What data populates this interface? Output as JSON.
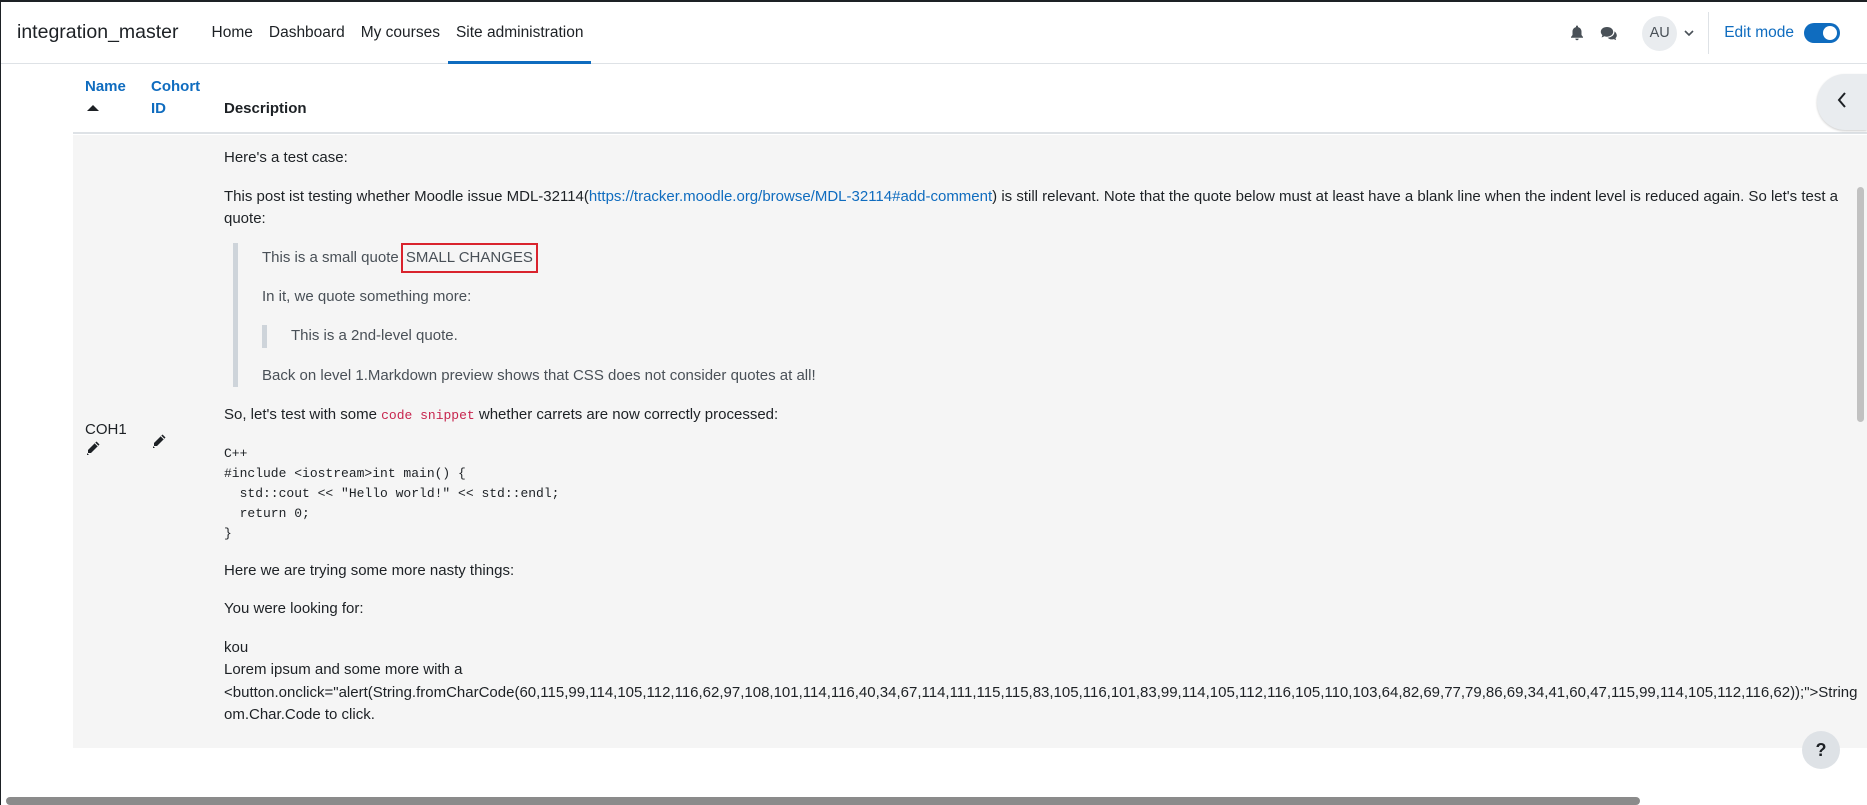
{
  "navbar": {
    "brand": "integration_master",
    "links": [
      {
        "label": "Home"
      },
      {
        "label": "Dashboard"
      },
      {
        "label": "My courses"
      },
      {
        "label": "Site administration"
      }
    ],
    "avatar_initials": "AU",
    "edit_mode_label": "Edit mode"
  },
  "table": {
    "headers": {
      "name": "Name",
      "cohort_id_line1": "Cohort",
      "cohort_id_line2": "ID",
      "description": "Description"
    },
    "row": {
      "name": "COH1",
      "desc": {
        "p1": "Here's a test case:",
        "p2_before": "This post ist testing whether Moodle issue MDL-32114(",
        "p2_link": "https://tracker.moodle.org/browse/MDL-32114#add-comment",
        "p2_after": ") is still relevant. Note that the quote below must at least have a blank line when the indent level is reduced again. So let's test a quote:",
        "q1_text": "This is a small quote",
        "q1_highlight": "SMALL CHANGES",
        "q2": "In it, we quote something more:",
        "q3": "This is a 2nd-level quote.",
        "q4": "Back on level 1.Markdown preview shows that CSS does not consider quotes at all!",
        "p3_before": "So, let's test with some ",
        "p3_code": "code snippet",
        "p3_after": " whether carrets are now correctly processed:",
        "code_block": "C++\n#include <iostream>int main() {\n  std::cout << \"Hello world!\" << std::endl;\n  return 0;\n}",
        "p4": "Here we are trying some more nasty things:",
        "p5": "You were looking for:",
        "p6_line1": "kou",
        "p6_line2": "Lorem ipsum and some more with a",
        "p6_line3": "<button.onclick=\"alert(String.fromCharCode(60,115,99,114,105,112,116,62,97,108,101,114,116,40,34,67,114,111,115,115,83,105,116,101,83,99,114,105,112,116,105,110,103,64,82,69,77,79,86,69,34,41,60,47,115,99,114,105,112,116,62));\">String",
        "p6_line4": "om.Char.Code to click."
      }
    }
  },
  "help_label": "?"
}
